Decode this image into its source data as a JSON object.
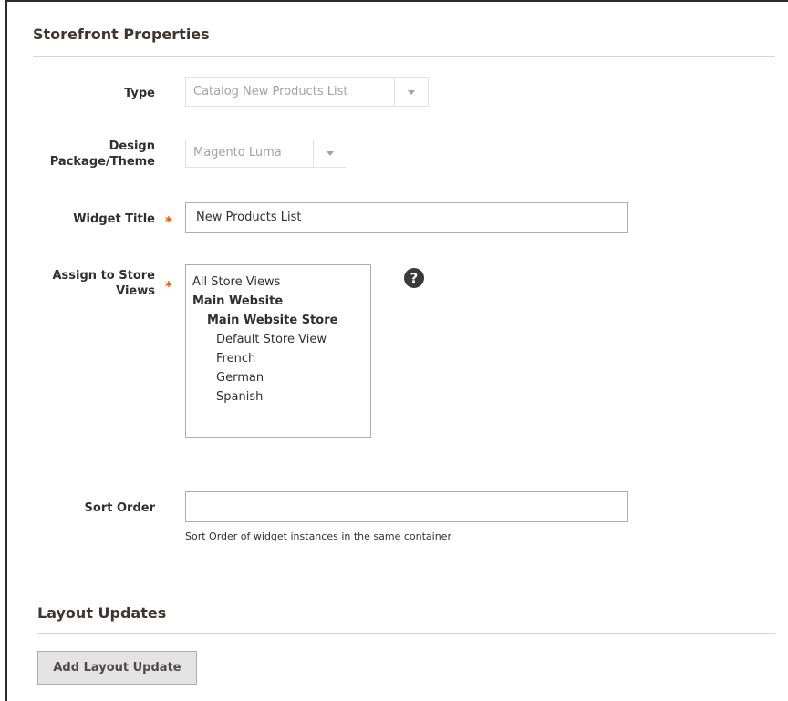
{
  "storefront": {
    "title": "Storefront Properties",
    "type": {
      "label": "Type",
      "value": "Catalog New Products List"
    },
    "theme": {
      "label_line1": "Design",
      "label_line2": "Package/Theme",
      "value": "Magento Luma"
    },
    "widget_title": {
      "label": "Widget Title",
      "required_mark": "*",
      "value": "New Products List"
    },
    "store_views": {
      "label_line1": "Assign to Store",
      "label_line2": "Views",
      "required_mark": "*",
      "help_icon": "question-circle-icon",
      "help_glyph": "?",
      "options": [
        {
          "label": "All Store Views",
          "bold": false,
          "level": 1
        },
        {
          "label": "Main Website",
          "bold": true,
          "level": 1
        },
        {
          "label": "Main Website Store",
          "bold": true,
          "level": 2
        },
        {
          "label": "Default Store View",
          "bold": false,
          "level": 3
        },
        {
          "label": "French",
          "bold": false,
          "level": 3
        },
        {
          "label": "German",
          "bold": false,
          "level": 3
        },
        {
          "label": "Spanish",
          "bold": false,
          "level": 3
        }
      ]
    },
    "sort_order": {
      "label": "Sort Order",
      "value": "",
      "note": "Sort Order of widget instances in the same container"
    }
  },
  "layout_updates": {
    "title": "Layout Updates",
    "add_button": "Add Layout Update"
  },
  "colors": {
    "required": "#eb5202",
    "button_bg": "#e3e3e3",
    "rule": "#d6d6d6"
  }
}
